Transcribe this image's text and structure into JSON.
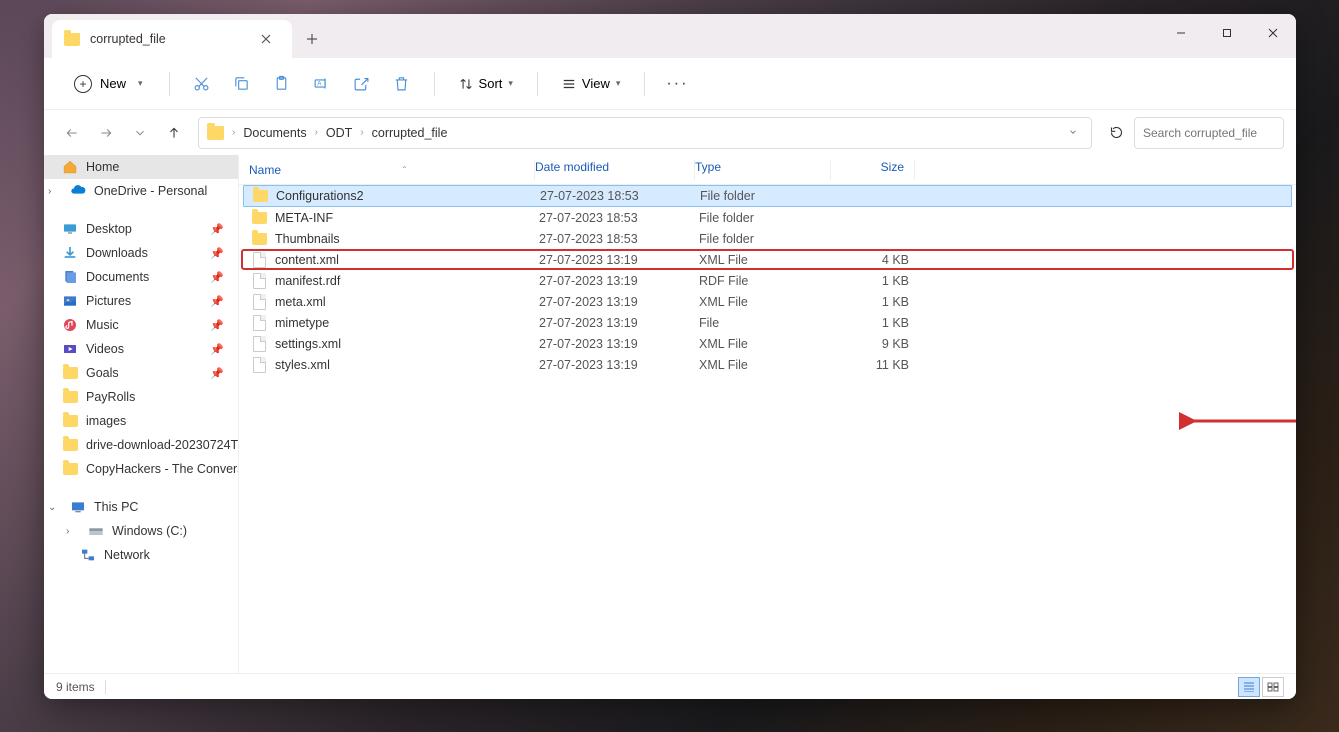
{
  "tab": {
    "title": "corrupted_file"
  },
  "toolbar": {
    "new_label": "New",
    "sort_label": "Sort",
    "view_label": "View"
  },
  "breadcrumbs": [
    "Documents",
    "ODT",
    "corrupted_file"
  ],
  "search": {
    "placeholder": "Search corrupted_file"
  },
  "sidebar": {
    "home": "Home",
    "onedrive": "OneDrive - Personal",
    "quick": [
      {
        "label": "Desktop",
        "icon": "desktop",
        "pinned": true
      },
      {
        "label": "Downloads",
        "icon": "downloads",
        "pinned": true
      },
      {
        "label": "Documents",
        "icon": "documents",
        "pinned": true
      },
      {
        "label": "Pictures",
        "icon": "pictures",
        "pinned": true
      },
      {
        "label": "Music",
        "icon": "music",
        "pinned": true
      },
      {
        "label": "Videos",
        "icon": "videos",
        "pinned": true
      },
      {
        "label": "Goals",
        "icon": "folder",
        "pinned": true
      },
      {
        "label": "PayRolls",
        "icon": "folder",
        "pinned": false
      },
      {
        "label": "images",
        "icon": "folder",
        "pinned": false
      },
      {
        "label": "drive-download-20230724T",
        "icon": "folder",
        "pinned": false
      },
      {
        "label": "CopyHackers - The Convers",
        "icon": "folder",
        "pinned": false
      }
    ],
    "thispc": "This PC",
    "drive": "Windows (C:)",
    "network": "Network"
  },
  "columns": {
    "name": "Name",
    "date": "Date modified",
    "type": "Type",
    "size": "Size"
  },
  "files": [
    {
      "name": "Configurations2",
      "date": "27-07-2023 18:53",
      "type": "File folder",
      "size": "",
      "icon": "folder",
      "state": "selected"
    },
    {
      "name": "META-INF",
      "date": "27-07-2023 18:53",
      "type": "File folder",
      "size": "",
      "icon": "folder",
      "state": ""
    },
    {
      "name": "Thumbnails",
      "date": "27-07-2023 18:53",
      "type": "File folder",
      "size": "",
      "icon": "folder",
      "state": ""
    },
    {
      "name": "content.xml",
      "date": "27-07-2023 13:19",
      "type": "XML File",
      "size": "4 KB",
      "icon": "file",
      "state": "highlighted"
    },
    {
      "name": "manifest.rdf",
      "date": "27-07-2023 13:19",
      "type": "RDF File",
      "size": "1 KB",
      "icon": "file",
      "state": ""
    },
    {
      "name": "meta.xml",
      "date": "27-07-2023 13:19",
      "type": "XML File",
      "size": "1 KB",
      "icon": "file",
      "state": ""
    },
    {
      "name": "mimetype",
      "date": "27-07-2023 13:19",
      "type": "File",
      "size": "1 KB",
      "icon": "file",
      "state": ""
    },
    {
      "name": "settings.xml",
      "date": "27-07-2023 13:19",
      "type": "XML File",
      "size": "9 KB",
      "icon": "file",
      "state": ""
    },
    {
      "name": "styles.xml",
      "date": "27-07-2023 13:19",
      "type": "XML File",
      "size": "11 KB",
      "icon": "file",
      "state": ""
    }
  ],
  "status": {
    "item_count": "9 items"
  }
}
